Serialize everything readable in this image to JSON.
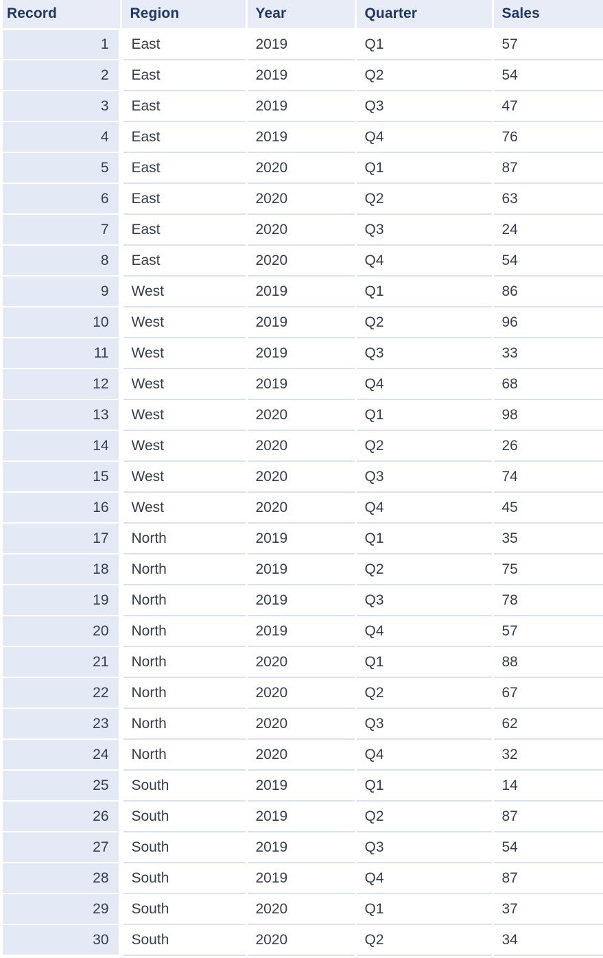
{
  "table": {
    "name": "sales-records-table",
    "columns": [
      {
        "key": "record",
        "label": "Record",
        "align": "right"
      },
      {
        "key": "region",
        "label": "Region",
        "align": "left"
      },
      {
        "key": "year",
        "label": "Year",
        "align": "left"
      },
      {
        "key": "quarter",
        "label": "Quarter",
        "align": "left"
      },
      {
        "key": "sales",
        "label": "Sales",
        "align": "left"
      }
    ],
    "rows": [
      {
        "record": "1",
        "region": "East",
        "year": "2019",
        "quarter": "Q1",
        "sales": "57"
      },
      {
        "record": "2",
        "region": "East",
        "year": "2019",
        "quarter": "Q2",
        "sales": "54"
      },
      {
        "record": "3",
        "region": "East",
        "year": "2019",
        "quarter": "Q3",
        "sales": "47"
      },
      {
        "record": "4",
        "region": "East",
        "year": "2019",
        "quarter": "Q4",
        "sales": "76"
      },
      {
        "record": "5",
        "region": "East",
        "year": "2020",
        "quarter": "Q1",
        "sales": "87"
      },
      {
        "record": "6",
        "region": "East",
        "year": "2020",
        "quarter": "Q2",
        "sales": "63"
      },
      {
        "record": "7",
        "region": "East",
        "year": "2020",
        "quarter": "Q3",
        "sales": "24"
      },
      {
        "record": "8",
        "region": "East",
        "year": "2020",
        "quarter": "Q4",
        "sales": "54"
      },
      {
        "record": "9",
        "region": "West",
        "year": "2019",
        "quarter": "Q1",
        "sales": "86"
      },
      {
        "record": "10",
        "region": "West",
        "year": "2019",
        "quarter": "Q2",
        "sales": "96"
      },
      {
        "record": "11",
        "region": "West",
        "year": "2019",
        "quarter": "Q3",
        "sales": "33"
      },
      {
        "record": "12",
        "region": "West",
        "year": "2019",
        "quarter": "Q4",
        "sales": "68"
      },
      {
        "record": "13",
        "region": "West",
        "year": "2020",
        "quarter": "Q1",
        "sales": "98"
      },
      {
        "record": "14",
        "region": "West",
        "year": "2020",
        "quarter": "Q2",
        "sales": "26"
      },
      {
        "record": "15",
        "region": "West",
        "year": "2020",
        "quarter": "Q3",
        "sales": "74"
      },
      {
        "record": "16",
        "region": "West",
        "year": "2020",
        "quarter": "Q4",
        "sales": "45"
      },
      {
        "record": "17",
        "region": "North",
        "year": "2019",
        "quarter": "Q1",
        "sales": "35"
      },
      {
        "record": "18",
        "region": "North",
        "year": "2019",
        "quarter": "Q2",
        "sales": "75"
      },
      {
        "record": "19",
        "region": "North",
        "year": "2019",
        "quarter": "Q3",
        "sales": "78"
      },
      {
        "record": "20",
        "region": "North",
        "year": "2019",
        "quarter": "Q4",
        "sales": "57"
      },
      {
        "record": "21",
        "region": "North",
        "year": "2020",
        "quarter": "Q1",
        "sales": "88"
      },
      {
        "record": "22",
        "region": "North",
        "year": "2020",
        "quarter": "Q2",
        "sales": "67"
      },
      {
        "record": "23",
        "region": "North",
        "year": "2020",
        "quarter": "Q3",
        "sales": "62"
      },
      {
        "record": "24",
        "region": "North",
        "year": "2020",
        "quarter": "Q4",
        "sales": "32"
      },
      {
        "record": "25",
        "region": "South",
        "year": "2019",
        "quarter": "Q1",
        "sales": "14"
      },
      {
        "record": "26",
        "region": "South",
        "year": "2019",
        "quarter": "Q2",
        "sales": "87"
      },
      {
        "record": "27",
        "region": "South",
        "year": "2019",
        "quarter": "Q3",
        "sales": "54"
      },
      {
        "record": "28",
        "region": "South",
        "year": "2019",
        "quarter": "Q4",
        "sales": "87"
      },
      {
        "record": "29",
        "region": "South",
        "year": "2020",
        "quarter": "Q1",
        "sales": "37"
      },
      {
        "record": "30",
        "region": "South",
        "year": "2020",
        "quarter": "Q2",
        "sales": "34"
      }
    ]
  },
  "colors": {
    "header_background": "#e8ecf7",
    "header_text": "#1f3864",
    "index_column_background": "#e4eaf5",
    "body_text": "#333f4f",
    "row_separator": "#d9e1f2",
    "cell_background": "#ffffff"
  }
}
